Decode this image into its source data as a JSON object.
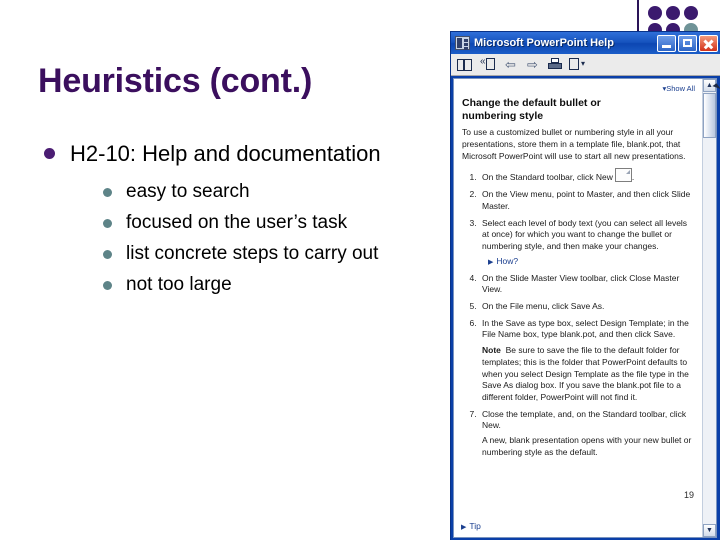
{
  "slide": {
    "title": "Heuristics (cont.)",
    "bullets": [
      {
        "text": "H2-10: Help and documentation",
        "children": [
          "easy to search",
          "focused on the user’s task",
          "list concrete steps to carry out",
          "not too large"
        ]
      }
    ],
    "decoration": {
      "dot_color": "#3b1a6e",
      "accent_dot_color": "#6f9397",
      "title_color": "#3b0f5e"
    }
  },
  "help_window": {
    "title": "Microsoft PowerPoint Help",
    "window_buttons": {
      "minimize": "Minimize",
      "maximize": "Maximize",
      "close": "Close"
    },
    "toolbar": [
      {
        "name": "show-hide-tabs",
        "label": "Show/Hide Tabs"
      },
      {
        "name": "back-to-contents",
        "label": "Contents"
      },
      {
        "name": "back",
        "label": "Back"
      },
      {
        "name": "forward",
        "label": "Forward"
      },
      {
        "name": "print",
        "label": "Print"
      },
      {
        "name": "options",
        "label": "Options"
      }
    ],
    "show_all": "Show All",
    "heading": "Change the default bullet or numbering style",
    "intro": "To use a customized bullet or numbering style in all your presentations, store them in a template file, blank.pot, that Microsoft PowerPoint will use to start all new presentations.",
    "steps": [
      "On the Standard toolbar, click New",
      "On the View menu, point to Master, and then click Slide Master.",
      "Select each level of body text (you can select all levels at once) for which you want to change the bullet or numbering style, and then make your changes.",
      "On the Slide Master View toolbar, click Close Master View.",
      "On the File menu, click Save As.",
      "In the Save as type box, select Design Template; in the File Name box, type blank.pot, and then click Save.",
      "Close the template, and, on the Standard toolbar, click New."
    ],
    "how_link": "How?",
    "note_label": "Note",
    "note_text": "Be sure to save the file to the default folder for templates; this is the folder that PowerPoint defaults to when you select Design Template as the file type in the Save As dialog box. If you save the blank.pot file to a different folder, PowerPoint will not find it.",
    "final_paragraph": "A new, blank presentation opens with your new bullet or numbering style as the default.",
    "tip_link": "Tip",
    "slide_number": "19",
    "colors": {
      "titlebar": "#0c46b2",
      "link": "#1b3f8f",
      "close_button": "#d2311a"
    }
  }
}
